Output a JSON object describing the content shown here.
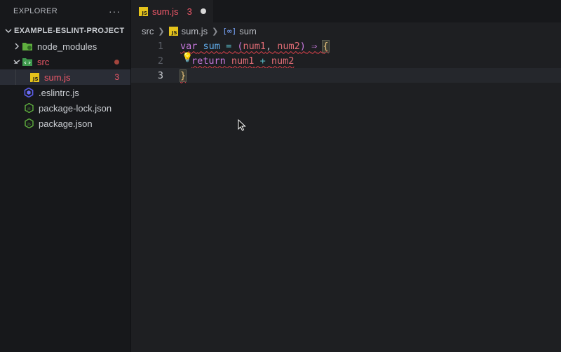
{
  "sidebar": {
    "title": "EXPLORER",
    "more": "···",
    "project": "EXAMPLE-ESLINT-PROJECT",
    "items": [
      {
        "label": "node_modules"
      },
      {
        "label": "src"
      },
      {
        "label": "sum.js",
        "badge": "3"
      },
      {
        "label": ".eslintrc.js"
      },
      {
        "label": "package-lock.json"
      },
      {
        "label": "package.json"
      }
    ]
  },
  "tab": {
    "icon_text": "JS",
    "name": "sum.js",
    "count": "3"
  },
  "breadcrumb": {
    "folder": "src",
    "file": "sum.js",
    "symbol": "sum"
  },
  "editor": {
    "line_numbers": [
      "1",
      "2",
      "3"
    ],
    "line1": {
      "kw": "var",
      "name": "sum",
      "eq": "=",
      "open": "(",
      "p1": "num1",
      "comma": ",",
      "p2": "num2",
      "close": ")",
      "arrow": "⇒",
      "brace": "{"
    },
    "line2": {
      "kw": "return",
      "a": "num1",
      "op": "+",
      "b": "num2"
    },
    "line3": {
      "brace": "}"
    }
  },
  "colors": {
    "accent": "#f1596a",
    "js_badge": "#e5c31b",
    "keyword": "#c678dd",
    "function": "#61afef",
    "param": "#e06c75"
  }
}
